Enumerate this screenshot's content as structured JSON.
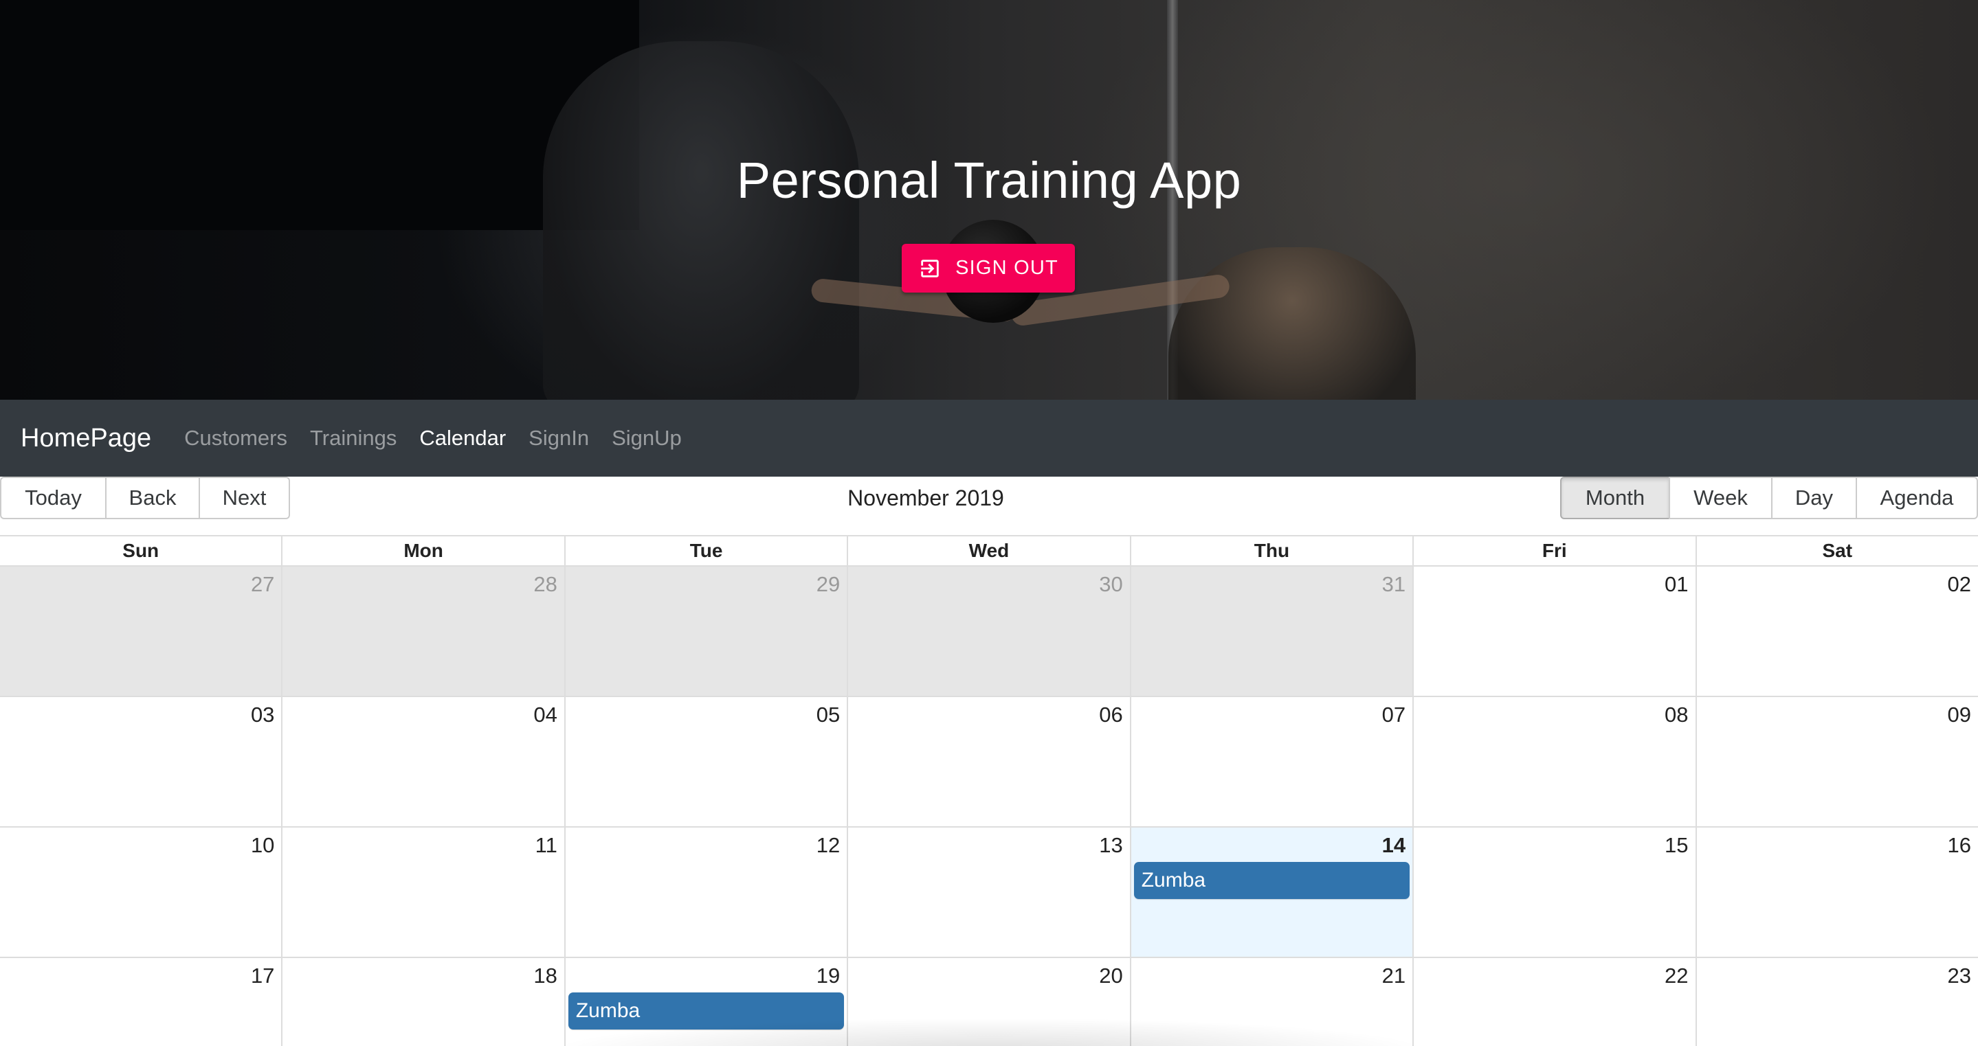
{
  "hero": {
    "title": "Personal Training App",
    "signout_label": "SIGN OUT",
    "signout_icon": "exit-to-app-icon",
    "signout_color": "#f50057"
  },
  "navbar": {
    "brand": "HomePage",
    "links": [
      {
        "label": "Customers",
        "active": false
      },
      {
        "label": "Trainings",
        "active": false
      },
      {
        "label": "Calendar",
        "active": true
      },
      {
        "label": "SignIn",
        "active": false
      },
      {
        "label": "SignUp",
        "active": false
      }
    ]
  },
  "toolbar": {
    "today": "Today",
    "back": "Back",
    "next": "Next",
    "label": "November 2019",
    "views": [
      "Month",
      "Week",
      "Day",
      "Agenda"
    ],
    "active_view": "Month"
  },
  "calendar": {
    "weekdays": [
      "Sun",
      "Mon",
      "Tue",
      "Wed",
      "Thu",
      "Fri",
      "Sat"
    ],
    "weeks": [
      [
        {
          "date": "27",
          "off": true
        },
        {
          "date": "28",
          "off": true
        },
        {
          "date": "29",
          "off": true
        },
        {
          "date": "30",
          "off": true
        },
        {
          "date": "31",
          "off": true
        },
        {
          "date": "01"
        },
        {
          "date": "02"
        }
      ],
      [
        {
          "date": "03"
        },
        {
          "date": "04"
        },
        {
          "date": "05"
        },
        {
          "date": "06"
        },
        {
          "date": "07"
        },
        {
          "date": "08"
        },
        {
          "date": "09"
        }
      ],
      [
        {
          "date": "10"
        },
        {
          "date": "11"
        },
        {
          "date": "12"
        },
        {
          "date": "13"
        },
        {
          "date": "14",
          "today": true,
          "event": "Zumba"
        },
        {
          "date": "15"
        },
        {
          "date": "16"
        }
      ],
      [
        {
          "date": "17"
        },
        {
          "date": "18"
        },
        {
          "date": "19",
          "event": "Zumba"
        },
        {
          "date": "20"
        },
        {
          "date": "21"
        },
        {
          "date": "22"
        },
        {
          "date": "23"
        }
      ]
    ],
    "event_color": "#3174ad",
    "today_color": "#eaf6ff"
  }
}
